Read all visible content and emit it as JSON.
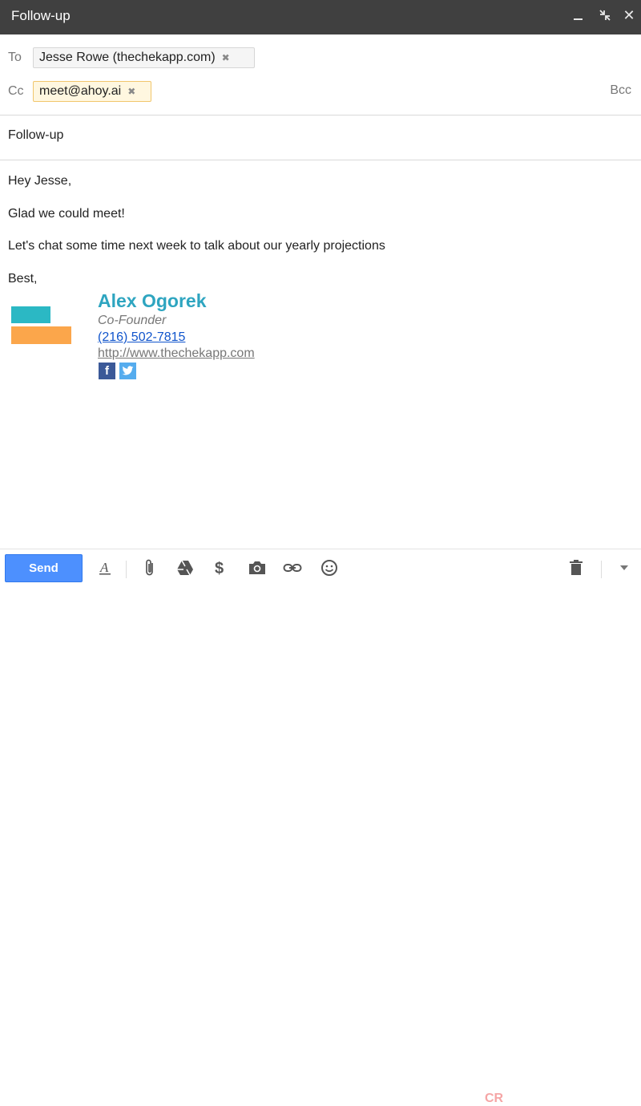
{
  "window": {
    "title": "Follow-up",
    "close_glyph": "✕"
  },
  "recipients": {
    "to_label": "To",
    "to_chip": "Jesse Rowe (thechekapp.com)",
    "cc_label": "Cc",
    "cc_chip": "meet@ahoy.ai",
    "bcc_label": "Bcc",
    "remove_glyph": "✖"
  },
  "subject": "Follow-up",
  "body": {
    "lines": [
      "Hey Jesse,",
      "Glad we could meet!",
      "Let's chat some time next week to talk about our yearly projections",
      "Best,"
    ]
  },
  "signature": {
    "name": "Alex Ogorek",
    "role": "Co-Founder",
    "phone": "(216) 502-7815",
    "website": "http://www.thechekapp.com",
    "facebook_glyph": "f",
    "colors": {
      "name": "#2ea5c0",
      "bar_top": "#2bb8c4",
      "bar_bottom": "#fba64b"
    }
  },
  "toolbar": {
    "send_label": "Send",
    "icons": [
      "format-text-icon",
      "attach-icon",
      "drive-icon",
      "money-icon",
      "camera-icon",
      "link-icon",
      "emoji-icon",
      "trash-icon",
      "more-options-icon"
    ],
    "accent": "#4d90fe"
  }
}
